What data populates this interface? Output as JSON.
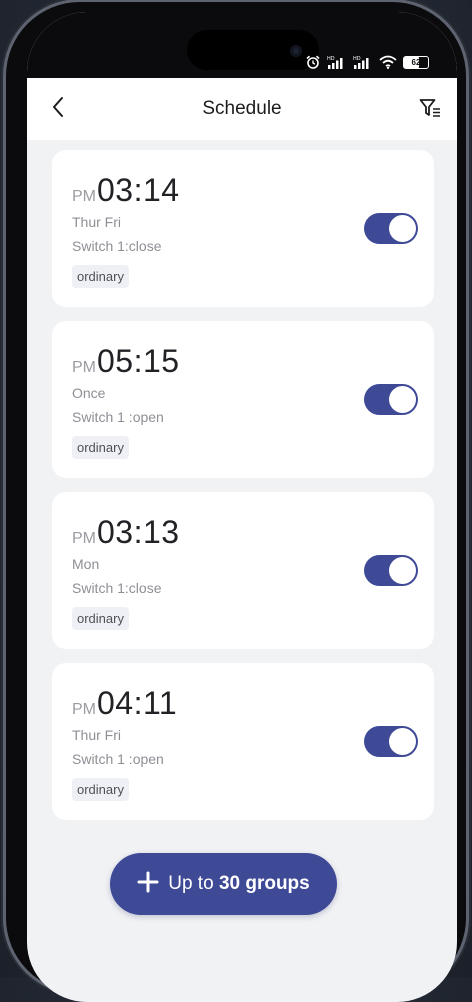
{
  "status_bar": {
    "battery_level": "62",
    "battery_percent": 62,
    "icons": [
      "alarm-icon",
      "hd-signal-icon",
      "hd-signal-icon",
      "wifi-icon",
      "battery-icon"
    ]
  },
  "header": {
    "title": "Schedule",
    "back_icon": "chevron-left-icon",
    "filter_icon": "filter-icon"
  },
  "schedules": [
    {
      "ampm": "PM",
      "time": "03:14",
      "days": "Thur Fri",
      "action": "Switch 1:close",
      "tag": "ordinary",
      "enabled": true
    },
    {
      "ampm": "PM",
      "time": "05:15",
      "days": "Once",
      "action": "Switch 1 :open",
      "tag": "ordinary",
      "enabled": true
    },
    {
      "ampm": "PM",
      "time": "03:13",
      "days": "Mon",
      "action": "Switch 1:close",
      "tag": "ordinary",
      "enabled": true
    },
    {
      "ampm": "PM",
      "time": "04:11",
      "days": "Thur Fri",
      "action": "Switch 1 :open",
      "tag": "ordinary",
      "enabled": true
    }
  ],
  "add_button": {
    "icon": "plus-icon",
    "prefix": "Up to",
    "count": "30 groups"
  },
  "colors": {
    "accent": "#3f4a97",
    "background": "#f1f2f4",
    "card": "#ffffff",
    "tag_background": "#eef0f5",
    "secondary_text": "#8d8f95"
  }
}
